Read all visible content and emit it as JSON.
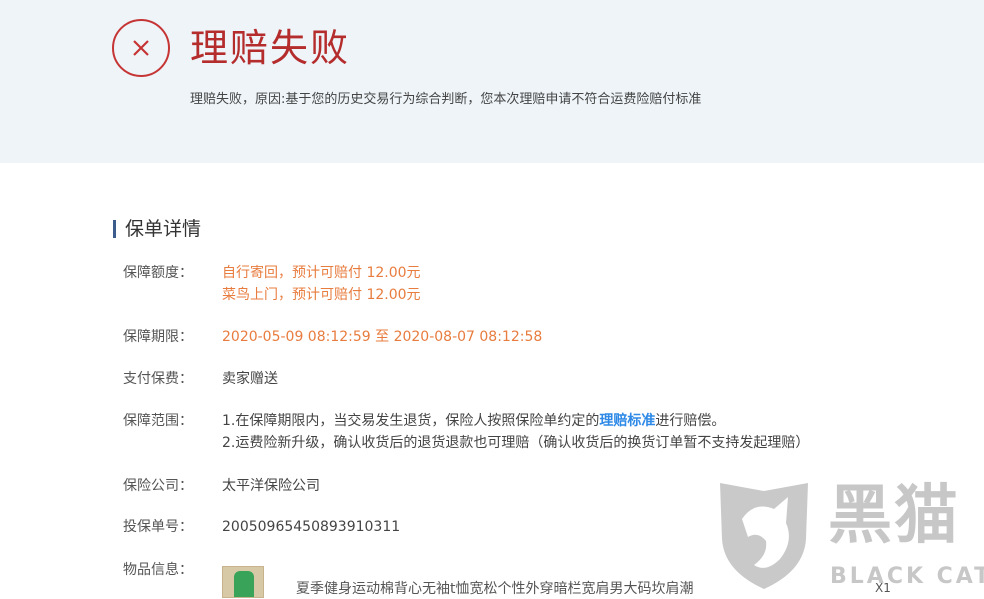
{
  "status": {
    "title": "理赔失败",
    "reason": "理赔失败，原因:基于您的历史交易行为综合判断，您本次理赔申请不符合运费险赔付标准"
  },
  "section": {
    "title": "保单详情"
  },
  "details": {
    "coverage": {
      "label": "保障额度：",
      "lines": [
        "自行寄回，预计可赔付 12.00元",
        "菜鸟上门，预计可赔付 12.00元"
      ]
    },
    "period": {
      "label": "保障期限：",
      "value": "2020-05-09 08:12:59 至 2020-08-07 08:12:58"
    },
    "payment": {
      "label": "支付保费：",
      "value": "卖家赠送"
    },
    "scope": {
      "label": "保障范围：",
      "line1_prefix": "1.在保障期限内，当交易发生退货，保险人按照保险单约定的",
      "line1_link": "理赔标准",
      "line1_suffix": "进行赔偿。",
      "line2": "2.运费险新升级，确认收货后的退货退款也可理赔（确认收货后的换货订单暂不支持发起理赔）"
    },
    "company": {
      "label": "保险公司：",
      "value": "太平洋保险公司"
    },
    "policy_no": {
      "label": "投保单号：",
      "value": "20050965450893910311"
    },
    "item": {
      "label": "物品信息：",
      "title": "夏季健身运动棉背心无袖t恤宽松个性外穿暗栏宽肩男大码坎肩潮",
      "qty": "X1"
    }
  },
  "watermark": {
    "cn": "黑猫",
    "en": "BLACK CAT"
  },
  "colors": {
    "fail_red": "#b52c2c",
    "orange_value": "#e87c3e",
    "link_blue": "#2e8ae6",
    "banner_bg": "#eef4f8"
  },
  "icons": {
    "status": "fail-x-circle-icon",
    "watermark": "black-cat-logo-icon"
  }
}
